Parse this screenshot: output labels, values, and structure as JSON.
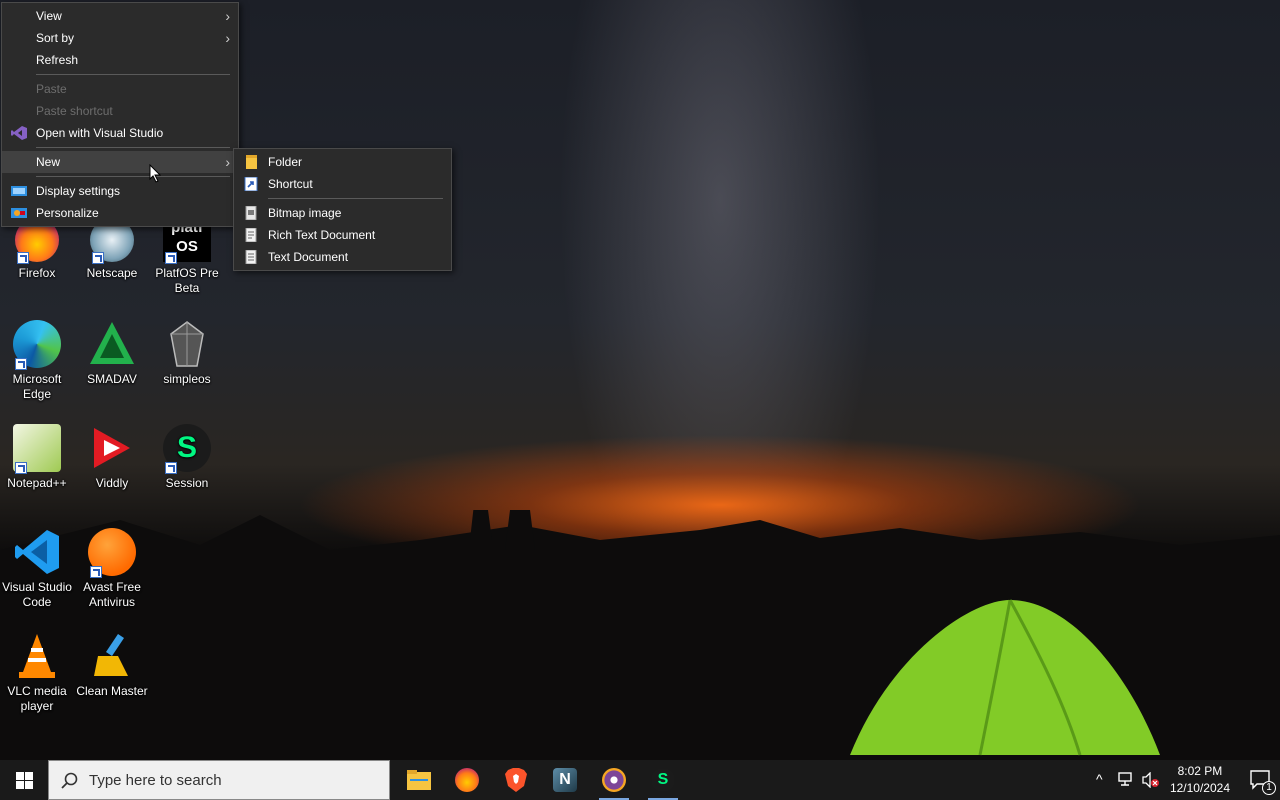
{
  "context_menu": {
    "items": [
      {
        "label": "View",
        "submenu": true
      },
      {
        "label": "Sort by",
        "submenu": true
      },
      {
        "label": "Refresh"
      },
      {
        "label": "Paste",
        "disabled": true
      },
      {
        "label": "Paste shortcut",
        "disabled": true
      },
      {
        "label": "Open with Visual Studio",
        "icon": "visual-studio-icon"
      },
      {
        "label": "New",
        "submenu": true,
        "highlighted": true
      },
      {
        "label": "Display settings",
        "icon": "display-icon"
      },
      {
        "label": "Personalize",
        "icon": "personalize-icon"
      }
    ]
  },
  "new_submenu": {
    "items": [
      {
        "label": "Folder",
        "icon": "folder-icon"
      },
      {
        "label": "Shortcut",
        "icon": "shortcut-icon"
      },
      {
        "label": "Bitmap image",
        "icon": "bitmap-file-icon"
      },
      {
        "label": "Rich Text Document",
        "icon": "document-icon"
      },
      {
        "label": "Text Document",
        "icon": "text-file-icon"
      }
    ]
  },
  "desktop_icons": [
    {
      "label": "Firefox",
      "icon": "firefox-icon"
    },
    {
      "label": "Netscape",
      "icon": "netscape-icon"
    },
    {
      "label": "PlatfOS Pre Beta",
      "icon": "platfos-icon",
      "logo_text": "platf OS"
    },
    {
      "label": "Microsoft Edge",
      "icon": "edge-icon"
    },
    {
      "label": "SMADAV",
      "icon": "smadav-icon"
    },
    {
      "label": "simpleos",
      "icon": "simpleos-icon"
    },
    {
      "label": "Notepad++",
      "icon": "notepadpp-icon"
    },
    {
      "label": "Viddly",
      "icon": "viddly-icon"
    },
    {
      "label": "Session",
      "icon": "session-icon"
    },
    {
      "label": "Visual Studio Code",
      "icon": "vscode-icon"
    },
    {
      "label": "Avast Free Antivirus",
      "icon": "avast-icon"
    },
    {
      "label": "VLC media player",
      "icon": "vlc-icon"
    },
    {
      "label": "Clean Master",
      "icon": "clean-master-icon"
    }
  ],
  "taskbar": {
    "search_placeholder": "Type here to search",
    "apps": [
      "file-explorer-icon",
      "firefox-icon",
      "brave-icon",
      "netscape-icon",
      "tor-browser-icon",
      "session-icon"
    ],
    "time": "8:02 PM",
    "date": "12/10/2024",
    "notification_count": "1"
  },
  "colors": {
    "menu_bg": "#2b2b2b",
    "menu_highlight": "#414141",
    "taskbar_bg": "#1a1a1a",
    "disabled_text": "#6d6d6d"
  }
}
